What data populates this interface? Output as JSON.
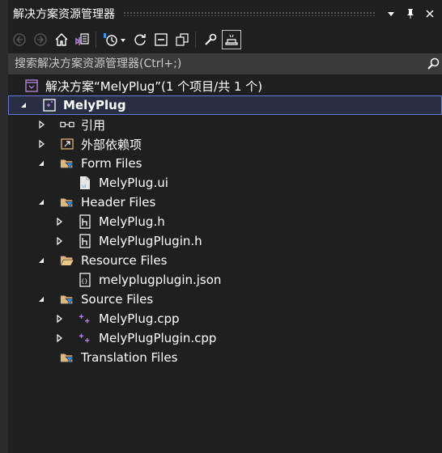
{
  "panel": {
    "title": "解决方案资源管理器",
    "controls": [
      "dropdown-icon",
      "pin-icon",
      "close-icon"
    ]
  },
  "toolbar": {
    "buttons": [
      "back-icon",
      "forward-icon",
      "home-icon",
      "vs-switch-view-icon",
      "history-icon",
      "sync-icon",
      "collapse-all-icon",
      "show-all-files-icon",
      "properties-icon",
      "preview-selected-icon"
    ]
  },
  "search": {
    "placeholder": "搜索解决方案资源管理器(Ctrl+;)"
  },
  "tree": {
    "solution": "解决方案“MelyPlug”(1 个项目/共 1 个)",
    "project": "MelyPlug",
    "references": "引用",
    "external_deps": "外部依赖项",
    "form_files": "Form Files",
    "form_ui": "MelyPlug.ui",
    "header_files": "Header Files",
    "header_h1": "MelyPlug.h",
    "header_h2": "MelyPlugPlugin.h",
    "resource_files": "Resource Files",
    "resource_json": "melyplugplugin.json",
    "source_files": "Source Files",
    "source_cpp1": "MelyPlug.cpp",
    "source_cpp2": "MelyPlugPlugin.cpp",
    "translation_files": "Translation Files"
  },
  "colors": {
    "background": "#1f1f1f",
    "selection": "#2a2e45",
    "selection_border": "#6a75d6",
    "folder": "#dcb67a",
    "filter": "#3794ff",
    "cpp": "#b180d7"
  }
}
